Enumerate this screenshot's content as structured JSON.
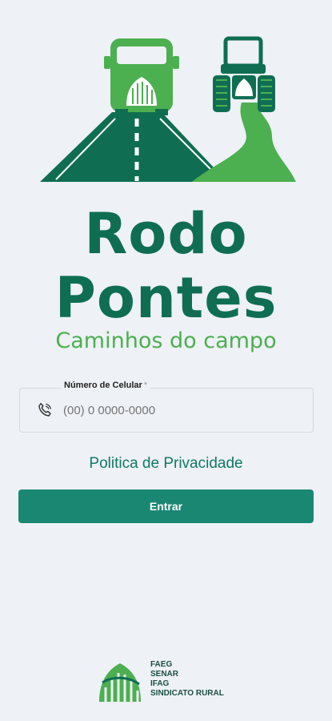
{
  "brand": {
    "title_line1": "Rodo",
    "title_line2": "Pontes",
    "subtitle": "Caminhos do campo"
  },
  "form": {
    "phone_label": "Número de Celular",
    "phone_required_mark": "*",
    "phone_placeholder": "(00) 0 0000-0000"
  },
  "links": {
    "privacy": "Politica de Privacidade"
  },
  "actions": {
    "enter_label": "Entrar"
  },
  "footer": {
    "partners": [
      "FAEG",
      "SENAR",
      "IFAG",
      "SINDICATO RURAL"
    ]
  },
  "colors": {
    "dark_green": "#0f6e52",
    "light_green": "#4caf50",
    "button": "#1a8773",
    "background": "#eef1f6"
  }
}
